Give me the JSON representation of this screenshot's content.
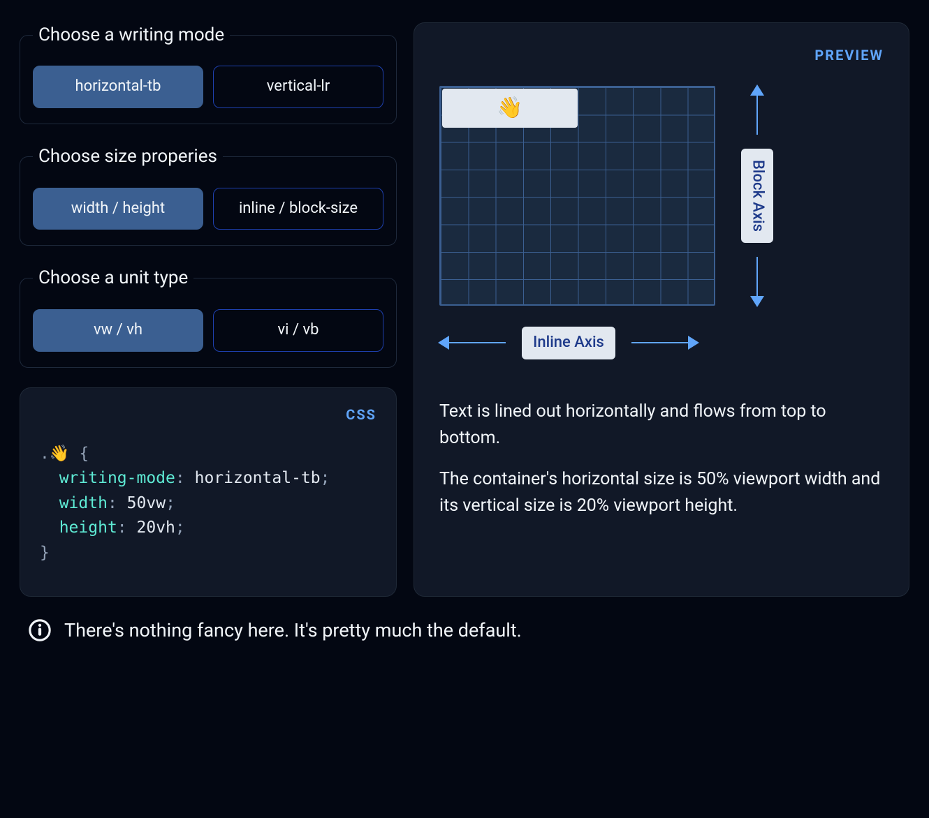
{
  "controls": {
    "writing_mode": {
      "legend": "Choose a writing mode",
      "options": [
        "horizontal-tb",
        "vertical-lr"
      ],
      "selected_index": 0
    },
    "size_props": {
      "legend": "Choose size properies",
      "options": [
        "width / height",
        "inline / block-size"
      ],
      "selected_index": 0
    },
    "unit_type": {
      "legend": "Choose a unit type",
      "options": [
        "vw / vh",
        "vi / vb"
      ],
      "selected_index": 0
    }
  },
  "code_panel": {
    "tag": "CSS",
    "selector_emoji": "👋",
    "rules": [
      {
        "prop": "writing-mode",
        "value": "horizontal-tb"
      },
      {
        "prop": "width",
        "value": "50vw"
      },
      {
        "prop": "height",
        "value": "20vh"
      }
    ]
  },
  "preview": {
    "tag": "PREVIEW",
    "wave_emoji": "👋",
    "inline_axis_label": "Inline Axis",
    "block_axis_label": "Block Axis",
    "explanation": [
      "Text is lined out horizontally and flows from top to bottom.",
      "The container's horizontal size is 50% viewport width and its vertical size is 20% viewport height."
    ]
  },
  "footer_note": "There's nothing fancy here. It's pretty much the default."
}
